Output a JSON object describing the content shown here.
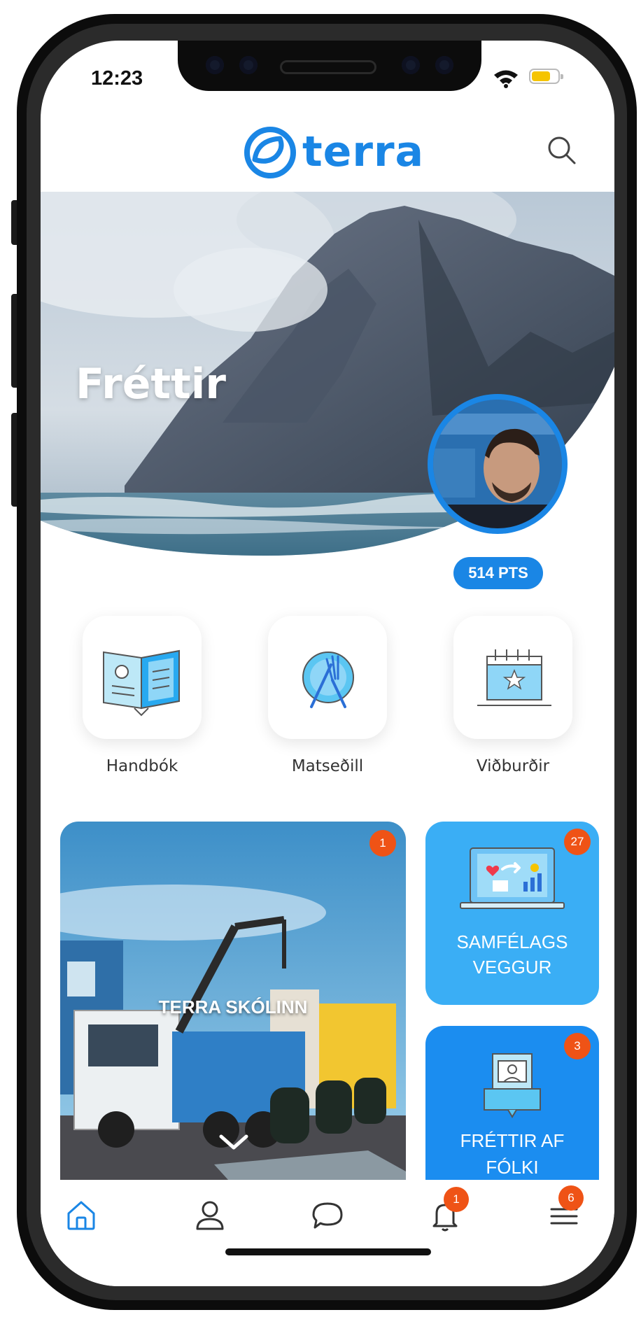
{
  "status": {
    "time": "12:23"
  },
  "app": {
    "logo_text": "terra"
  },
  "hero": {
    "title": "Fréttir",
    "points": "514 PTS"
  },
  "quick_links": [
    {
      "label": "Handbók",
      "icon": "book-icon"
    },
    {
      "label": "Matseðill",
      "icon": "plate-fork-knife-icon"
    },
    {
      "label": "Viðburðir",
      "icon": "calendar-icon"
    }
  ],
  "cards": {
    "school": {
      "label": "TERRA SKÓLINN",
      "badge": "1"
    },
    "community": {
      "label_line1": "SAMFÉLAGS",
      "label_line2": "VEGGUR",
      "badge": "27"
    },
    "people": {
      "label_line1": "FRÉTTIR AF",
      "label_line2": "FÓLKI",
      "badge": "3"
    }
  },
  "tabbar": {
    "notifications_badge": "1",
    "menu_badge": "6",
    "active_tab": "home"
  },
  "colors": {
    "brand_blue": "#1a86e5",
    "card_light_blue": "#3aaef5",
    "card_blue": "#1b8df0",
    "badge_orange": "#ef5316"
  }
}
